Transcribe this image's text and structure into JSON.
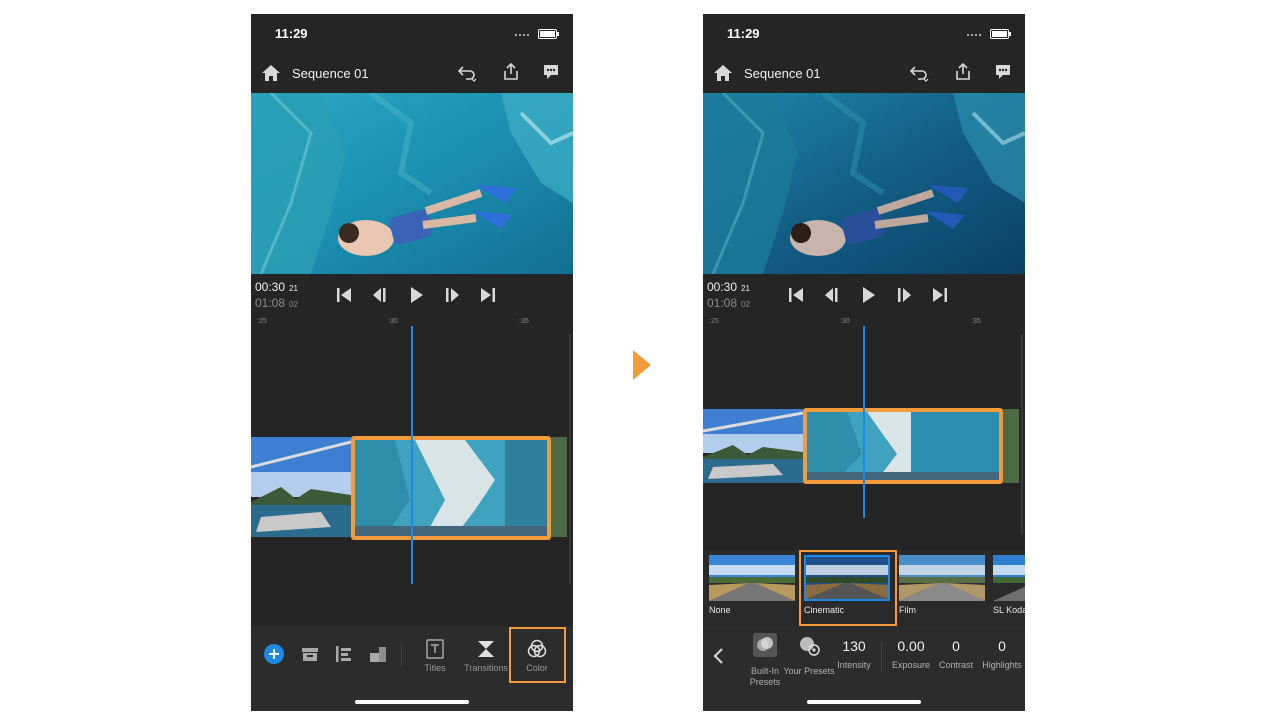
{
  "status_time": "11:29",
  "sequence_title": "Sequence 01",
  "timecode": {
    "current": "00:30",
    "current_frame": "21",
    "duration": "01:08",
    "duration_frame": "02"
  },
  "ruler_marks": [
    ":25",
    ":30",
    ":35"
  ],
  "toolbar": {
    "titles_label": "Titles",
    "transitions_label": "Transitions",
    "color_label": "Color"
  },
  "presets": [
    {
      "label": "None"
    },
    {
      "label": "Cinematic"
    },
    {
      "label": "Film"
    },
    {
      "label": "SL Koda"
    }
  ],
  "selected_preset": "Cinematic",
  "color_params": [
    {
      "value": "",
      "label": "Built-In Presets"
    },
    {
      "value": "",
      "label": "Your Presets"
    },
    {
      "value": "130",
      "label": "Intensity"
    },
    {
      "value": "0.00",
      "label": "Exposure"
    },
    {
      "value": "0",
      "label": "Contrast"
    },
    {
      "value": "0",
      "label": "Highlights"
    }
  ],
  "colors": {
    "accent_orange": "#f39a3a",
    "playhead_blue": "#1e88e5",
    "background": "#252525"
  },
  "icons": [
    "home-icon",
    "undo-icon",
    "share-icon",
    "chat-icon",
    "skip-start-icon",
    "step-back-icon",
    "play-icon",
    "step-forward-icon",
    "skip-end-icon",
    "add-icon",
    "media-icon",
    "align-icon",
    "crop-icon",
    "titles-icon",
    "transitions-icon",
    "color-icon",
    "back-chevron-icon",
    "built-in-presets-icon",
    "your-presets-icon"
  ]
}
